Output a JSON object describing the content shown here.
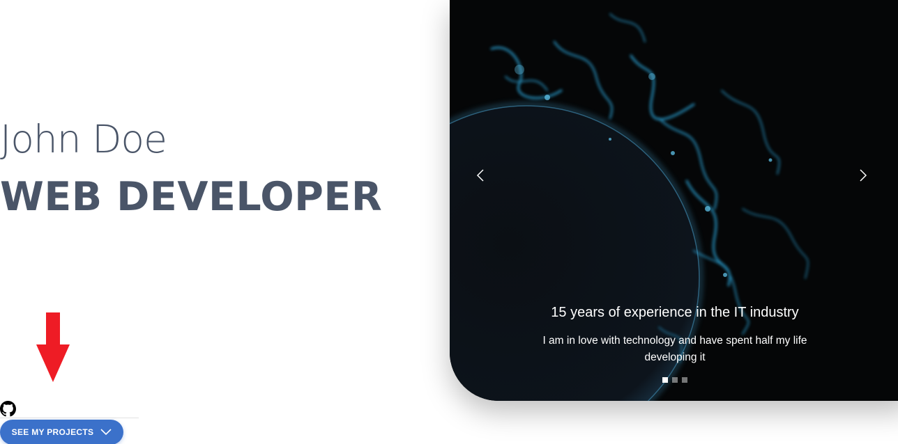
{
  "hero": {
    "name": "John Doe",
    "title": "WEB DEVELOPER"
  },
  "projects_button": {
    "label": "SEE MY PROJECTS",
    "icon": "chevron-down-icon"
  },
  "social": {
    "icon": "github-icon"
  },
  "annotation": {
    "icon": "red-arrow-icon"
  },
  "carousel": {
    "prev_icon": "chevron-left-icon",
    "next_icon": "chevron-right-icon",
    "slide": {
      "title": "15 years of experience in the IT industry",
      "text": "I am in love with technology and have spent half my life developing it"
    },
    "indicator_count": 3,
    "active_indicator": 1
  },
  "colors": {
    "hero_text": "#4a5568",
    "button": "#3b71ca",
    "arrow": "#ee1c25",
    "carousel_bg": "#050607",
    "glow": "#2aa3d6"
  }
}
